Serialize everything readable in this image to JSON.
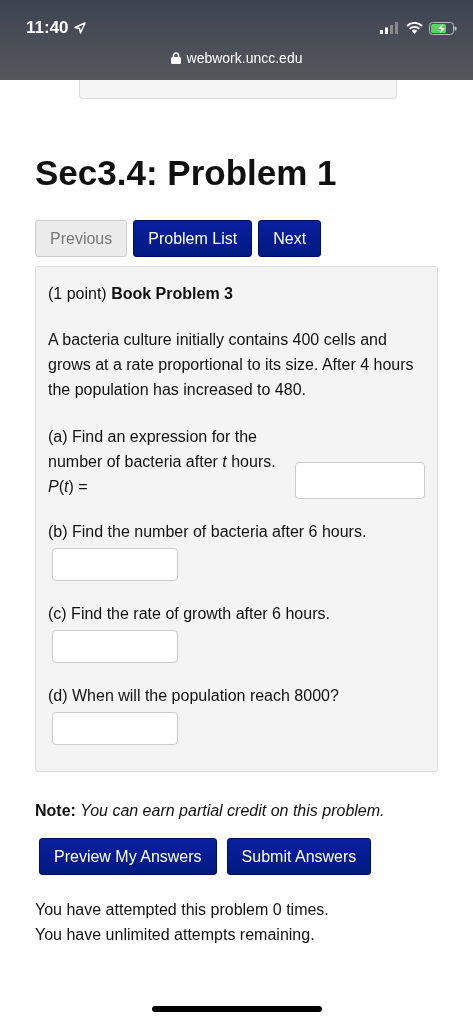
{
  "status_bar": {
    "time": "11:40",
    "url": "webwork.uncc.edu"
  },
  "title": "Sec3.4: Problem 1",
  "nav_buttons": [
    {
      "label": "Previous",
      "disabled": true
    },
    {
      "label": "Problem List",
      "disabled": false
    },
    {
      "label": "Next",
      "disabled": false
    }
  ],
  "problem": {
    "points": "(1 point)",
    "name": "Book Problem 3",
    "statement": "A bacteria culture initially contains 400 cells and grows at a rate proportional to its size. After 4 hours the population has increased to 480.",
    "parts": [
      {
        "kind": "inline",
        "prompt": "(a) Find an expression for the number of bacteria after *t* hours. *P*(*t*) ="
      },
      {
        "kind": "below",
        "prompt": "(b) Find the number of bacteria after 6 hours."
      },
      {
        "kind": "below",
        "prompt": "(c) Find the rate of growth after 6 hours."
      },
      {
        "kind": "below",
        "prompt": "(d) When will the population reach 8000?"
      }
    ]
  },
  "note": "**Note:** *You can earn partial credit on this problem.*",
  "submit_buttons": [
    {
      "label": "Preview My Answers",
      "disabled": false
    },
    {
      "label": "Submit Answers",
      "disabled": false
    }
  ],
  "attempts": [
    "You have attempted this problem 0 times.",
    "You have unlimited attempts remaining."
  ]
}
